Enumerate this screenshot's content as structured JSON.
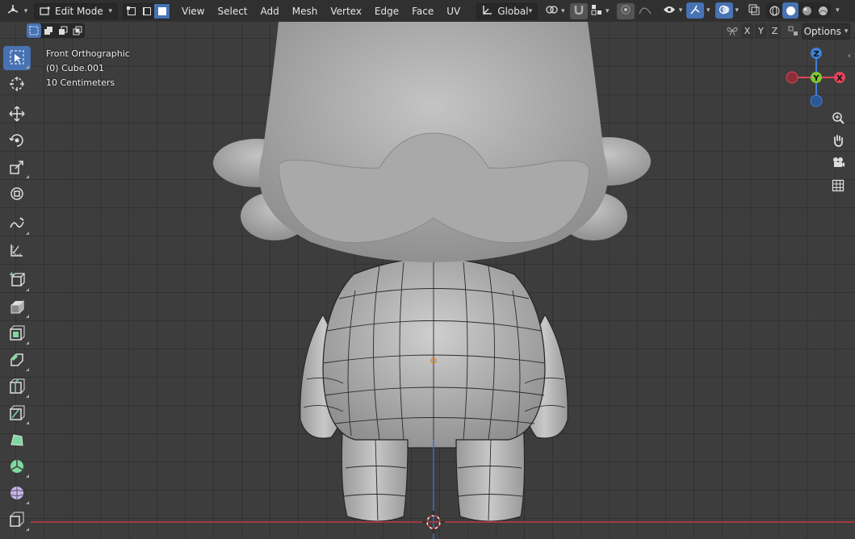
{
  "header": {
    "editor_type_icon": "view3d-icon",
    "mode": {
      "label": "Edit Mode",
      "icon": "edit-mode-icon"
    },
    "select_modes": [
      "vertex-select-icon",
      "edge-select-icon",
      "face-select-icon"
    ],
    "active_select_mode": 2,
    "menus": [
      "View",
      "Select",
      "Add",
      "Mesh",
      "Vertex",
      "Edge",
      "Face",
      "UV"
    ],
    "transform_orientation": {
      "label": "Global",
      "icon": "orientation-icon"
    },
    "pivot_icon": "pivot-icon",
    "snap_icon": "magnet-icon",
    "snap_target_icon": "snap-increment-icon",
    "proportional_icon": "proportional-icon",
    "falloff_icon": "falloff-curve-icon"
  },
  "right_header": {
    "visibility_icon": "eye-icon",
    "gizmo_icon": "gizmo-icon",
    "overlay_icon": "overlay-icon",
    "xray_icon": "xray-icon",
    "shading": [
      "wireframe-shading-icon",
      "solid-shading-icon",
      "material-shading-icon",
      "rendered-shading-icon"
    ],
    "active_shading": 1
  },
  "subheader": {
    "selection_modes": [
      "select-new-icon",
      "select-extend-icon",
      "select-subtract-icon",
      "select-intersect-icon"
    ],
    "mirror_icon": "butterfly-icon",
    "axes": [
      "X",
      "Y",
      "Z"
    ],
    "options_label": "Options"
  },
  "overlay": {
    "view_name": "Front Orthographic",
    "object_name": "(0) Cube.001",
    "scale": "10 Centimeters"
  },
  "toolbar": [
    {
      "icon": "select-box-icon",
      "active": true
    },
    {
      "icon": "cursor-icon",
      "active": false
    },
    {
      "icon": "move-icon",
      "active": false
    },
    {
      "icon": "rotate-icon",
      "active": false
    },
    {
      "icon": "scale-icon",
      "active": false
    },
    {
      "icon": "transform-icon",
      "active": false
    },
    {
      "icon": "annotate-icon",
      "active": false
    },
    {
      "icon": "measure-icon",
      "active": false
    },
    {
      "icon": "add-cube-icon",
      "active": false
    },
    {
      "icon": "extrude-icon",
      "active": false
    },
    {
      "icon": "inset-icon",
      "active": false
    },
    {
      "icon": "bevel-icon",
      "active": false
    },
    {
      "icon": "loop-cut-icon",
      "active": false
    },
    {
      "icon": "knife-icon",
      "active": false
    },
    {
      "icon": "poly-build-icon",
      "active": false
    },
    {
      "icon": "spin-icon",
      "active": false
    },
    {
      "icon": "smooth-icon",
      "active": false
    },
    {
      "icon": "shear-icon",
      "active": false
    }
  ],
  "gizmo": {
    "x": "X",
    "y": "Y",
    "z": "Z",
    "colors": {
      "x": "#e04458",
      "y": "#80c630",
      "z": "#3f80d8"
    }
  },
  "nav_buttons": [
    "zoom-icon",
    "hand-pan-icon",
    "camera-icon",
    "grid-ortho-icon"
  ],
  "colors": {
    "accent": "#4772b3",
    "header": "#303030",
    "viewport": "#3d3d3d"
  }
}
